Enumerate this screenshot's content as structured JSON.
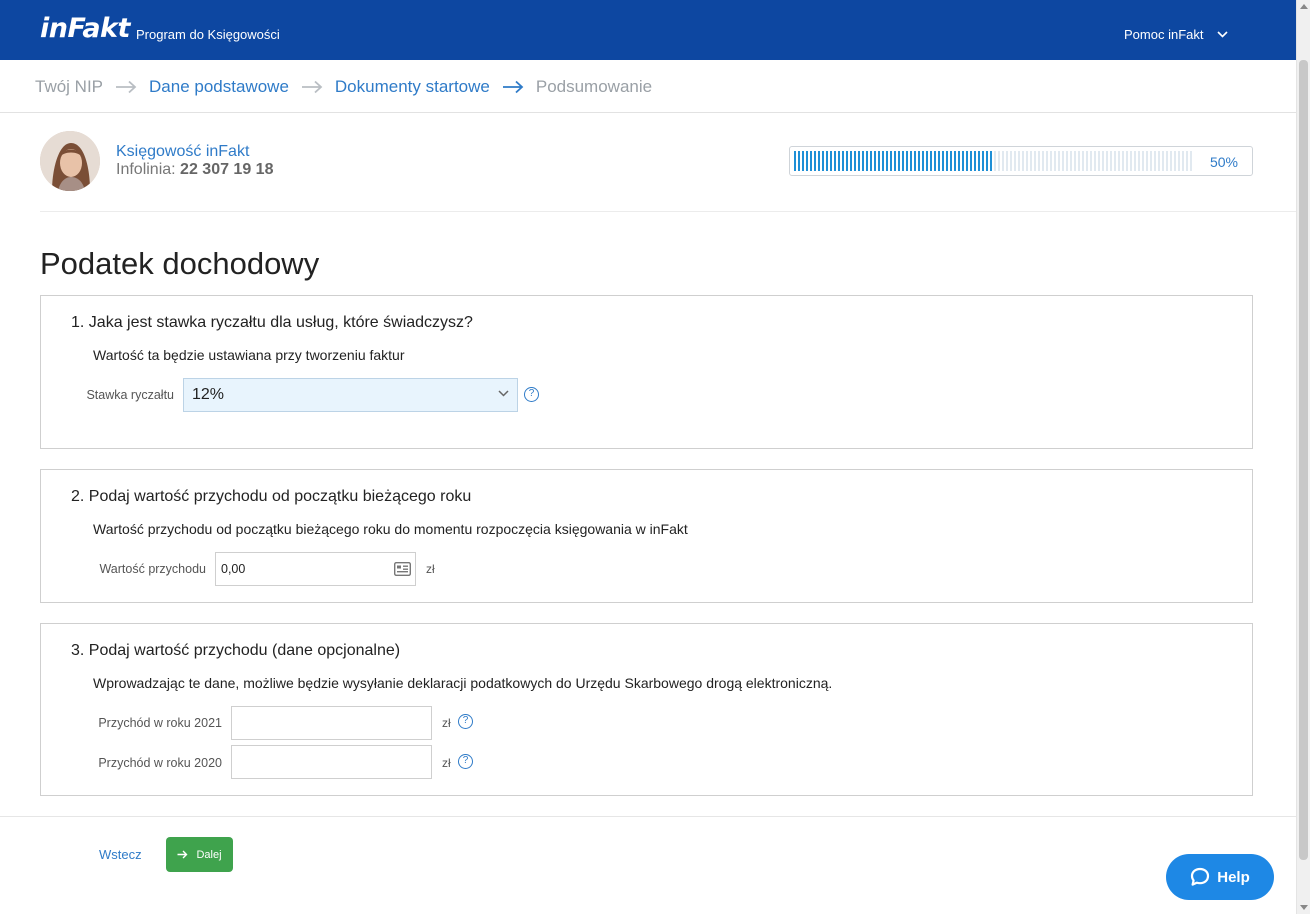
{
  "header": {
    "logo_text": "inFakt",
    "app_name": "Program do Księgowości",
    "help_menu": "Pomoc inFakt"
  },
  "breadcrumb": [
    {
      "label": "Twój NIP",
      "state": "inactive"
    },
    {
      "label": "Dane podstawowe",
      "state": "active"
    },
    {
      "label": "Dokumenty startowe",
      "state": "active"
    },
    {
      "label": "Podsumowanie",
      "state": "inactive"
    }
  ],
  "accountant": {
    "name": "Księgowość inFakt",
    "phone_label": "Infolinia: ",
    "phone": "22 307 19 18"
  },
  "progress": {
    "value": 50,
    "label": "50%"
  },
  "page_title": "Podatek dochodowy",
  "section1": {
    "title": "1. Jaka jest stawka ryczałtu dla usług, które świadczysz?",
    "desc": "Wartość ta będzie ustawiana przy tworzeniu faktur",
    "field_label": "Stawka ryczałtu",
    "selected": "12%"
  },
  "section2": {
    "title": "2. Podaj wartość przychodu od początku bieżącego roku",
    "desc": "Wartość przychodu od początku bieżącego roku do momentu rozpoczęcia księgowania w inFakt",
    "field_label": "Wartość przychodu",
    "value": "0,00",
    "unit": "zł"
  },
  "section3": {
    "title": "3. Podaj wartość przychodu (dane opcjonalne)",
    "desc": "Wprowadzając te dane, możliwe będzie wysyłanie deklaracji podatkowych do Urzędu Skarbowego drogą elektroniczną.",
    "fields": [
      {
        "label": "Przychód w roku 2021",
        "value": "",
        "unit": "zł"
      },
      {
        "label": "Przychód w roku 2020",
        "value": "",
        "unit": "zł"
      }
    ]
  },
  "footer": {
    "back_label": "Wstecz",
    "next_label": "Dalej",
    "help_label": "Help"
  },
  "colors": {
    "header_bg": "#0d47a1",
    "accent": "#2f7bc8",
    "next_btn": "#3fa34d",
    "help_btn": "#1e88e5"
  }
}
